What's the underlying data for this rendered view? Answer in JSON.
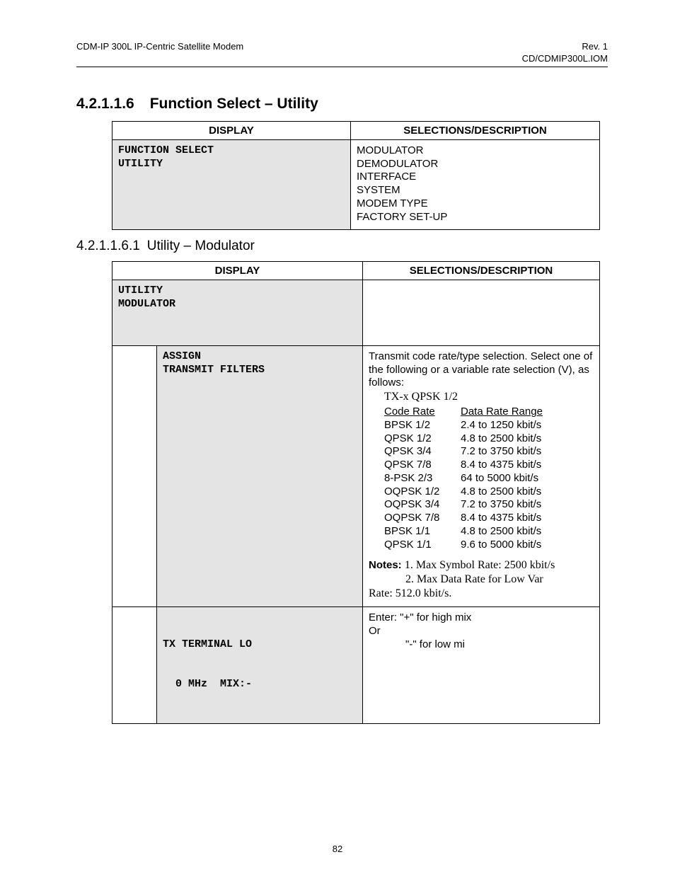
{
  "header": {
    "left": "CDM-IP 300L IP-Centric Satellite Modem",
    "right1": "Rev. 1",
    "right2": "CD/CDMIP300L.IOM"
  },
  "section1": {
    "number": "4.2.1.1.6",
    "title": "Function Select – Utility",
    "table": {
      "head_display": "DISPLAY",
      "head_sel": "SELECTIONS/DESCRIPTION",
      "display_line1": "FUNCTION SELECT",
      "display_line2": "UTILITY",
      "sel_lines": [
        "MODULATOR",
        "DEMODULATOR",
        "INTERFACE",
        "SYSTEM",
        "MODEM TYPE",
        "FACTORY SET-UP"
      ]
    }
  },
  "section2": {
    "number": "4.2.1.1.6.1",
    "title": "Utility – Modulator",
    "table": {
      "head_display": "DISPLAY",
      "head_sel": "SELECTIONS/DESCRIPTION",
      "row1_display_line1": "UTILITY",
      "row1_display_line2": "MODULATOR",
      "row2_display_line1": "ASSIGN",
      "row2_display_line2": "TRANSMIT FILTERS",
      "row2_desc_intro": "Transmit code rate/type selection. Select one of the following or a variable rate selection (V), as follows:",
      "row2_example": "TX-x QPSK  1/2",
      "row2_col_head_code": "Code Rate",
      "row2_col_head_range": "Data Rate Range",
      "row2_rates": [
        {
          "code": "BPSK 1/2",
          "range": "2.4 to 1250 kbit/s"
        },
        {
          "code": "QPSK 1/2",
          "range": "4.8 to 2500 kbit/s"
        },
        {
          "code": "QPSK 3/4",
          "range": "7.2 to 3750 kbit/s"
        },
        {
          "code": "QPSK 7/8",
          "range": "8.4 to 4375 kbit/s"
        },
        {
          "code": "8-PSK 2/3",
          "range": "64 to 5000 kbit/s"
        },
        {
          "code": "OQPSK 1/2",
          "range": "4.8 to 2500 kbit/s"
        },
        {
          "code": "OQPSK 3/4",
          "range": "7.2 to 3750 kbit/s"
        },
        {
          "code": "OQPSK 7/8",
          "range": "8.4 to 4375 kbit/s"
        },
        {
          "code": "BPSK 1/1",
          "range": "4.8 to 2500 kbit/s"
        },
        {
          "code": "QPSK 1/1",
          "range": "9.6 to 5000 kbit/s"
        }
      ],
      "row2_notes_label": "Notes:",
      "row2_note1": "1. Max Symbol Rate: 2500 kbit/s",
      "row2_note2_a": "2. Max Data Rate for Low Var",
      "row2_note2_b": "Rate: 512.0 kbit/s.",
      "row3_display_line1": "TX TERMINAL LO",
      "row3_display_line2": "  0 MHz  MIX:-",
      "row3_desc_line1": "Enter:   \"+\" for high mix",
      "row3_desc_line2": "Or",
      "row3_desc_line3": "\"-\" for low mi"
    }
  },
  "page_number": "82"
}
